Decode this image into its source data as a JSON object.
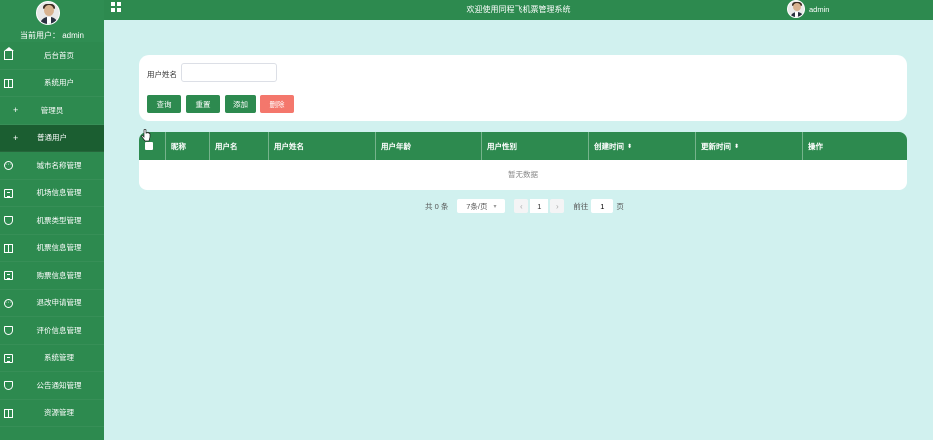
{
  "header": {
    "title": "欢迎使用同程飞机票管理系统",
    "username": "admin"
  },
  "sidebar": {
    "current_user": "当前用户： admin",
    "items": [
      {
        "label": "后台首页",
        "icon": "home-icon",
        "kind": "top",
        "active": false
      },
      {
        "label": "系统用户",
        "icon": "columns-icon",
        "kind": "top",
        "active": false
      },
      {
        "label": "管理员",
        "icon": "plus-icon",
        "kind": "sub",
        "active": false
      },
      {
        "label": "普通用户",
        "icon": "plus-icon",
        "kind": "sub",
        "active": true
      },
      {
        "label": "城市名称管理",
        "icon": "chat-icon",
        "kind": "top",
        "active": false
      },
      {
        "label": "机场信息管理",
        "icon": "document-icon",
        "kind": "top",
        "active": false
      },
      {
        "label": "机票类型管理",
        "icon": "shield-icon",
        "kind": "top",
        "active": false
      },
      {
        "label": "机票信息管理",
        "icon": "columns-icon",
        "kind": "top",
        "active": false
      },
      {
        "label": "购票信息管理",
        "icon": "document-icon",
        "kind": "top",
        "active": false
      },
      {
        "label": "退改申请管理",
        "icon": "chat-icon",
        "kind": "top",
        "active": false
      },
      {
        "label": "评价信息管理",
        "icon": "shield-icon",
        "kind": "top",
        "active": false
      },
      {
        "label": "系统管理",
        "icon": "document-icon",
        "kind": "top",
        "active": false
      },
      {
        "label": "公告通知管理",
        "icon": "shield-icon",
        "kind": "top",
        "active": false
      },
      {
        "label": "资源管理",
        "icon": "columns-icon",
        "kind": "top",
        "active": false
      }
    ]
  },
  "search": {
    "label": "用户姓名",
    "value": "",
    "placeholder": "",
    "buttons": {
      "query": "查询",
      "reset": "重置",
      "add": "添加",
      "delete": "删除"
    }
  },
  "table": {
    "columns": [
      {
        "label": "昵称",
        "sortable": false
      },
      {
        "label": "用户名",
        "sortable": false
      },
      {
        "label": "用户姓名",
        "sortable": false
      },
      {
        "label": "用户年龄",
        "sortable": false
      },
      {
        "label": "用户性别",
        "sortable": false
      },
      {
        "label": "创建时间",
        "sortable": true
      },
      {
        "label": "更新时间",
        "sortable": true
      },
      {
        "label": "操作",
        "sortable": false
      }
    ],
    "empty_text": "暂无数据"
  },
  "pagination": {
    "total": "共 0 条",
    "page_size": "7条/页",
    "current_page": "1",
    "goto_prefix": "前往",
    "goto_value": "1",
    "goto_suffix": "页"
  },
  "colors": {
    "primary": "#2d8a4f",
    "active_menu": "#1b5e31",
    "danger": "#f4776c",
    "background": "#d1f1ef"
  }
}
